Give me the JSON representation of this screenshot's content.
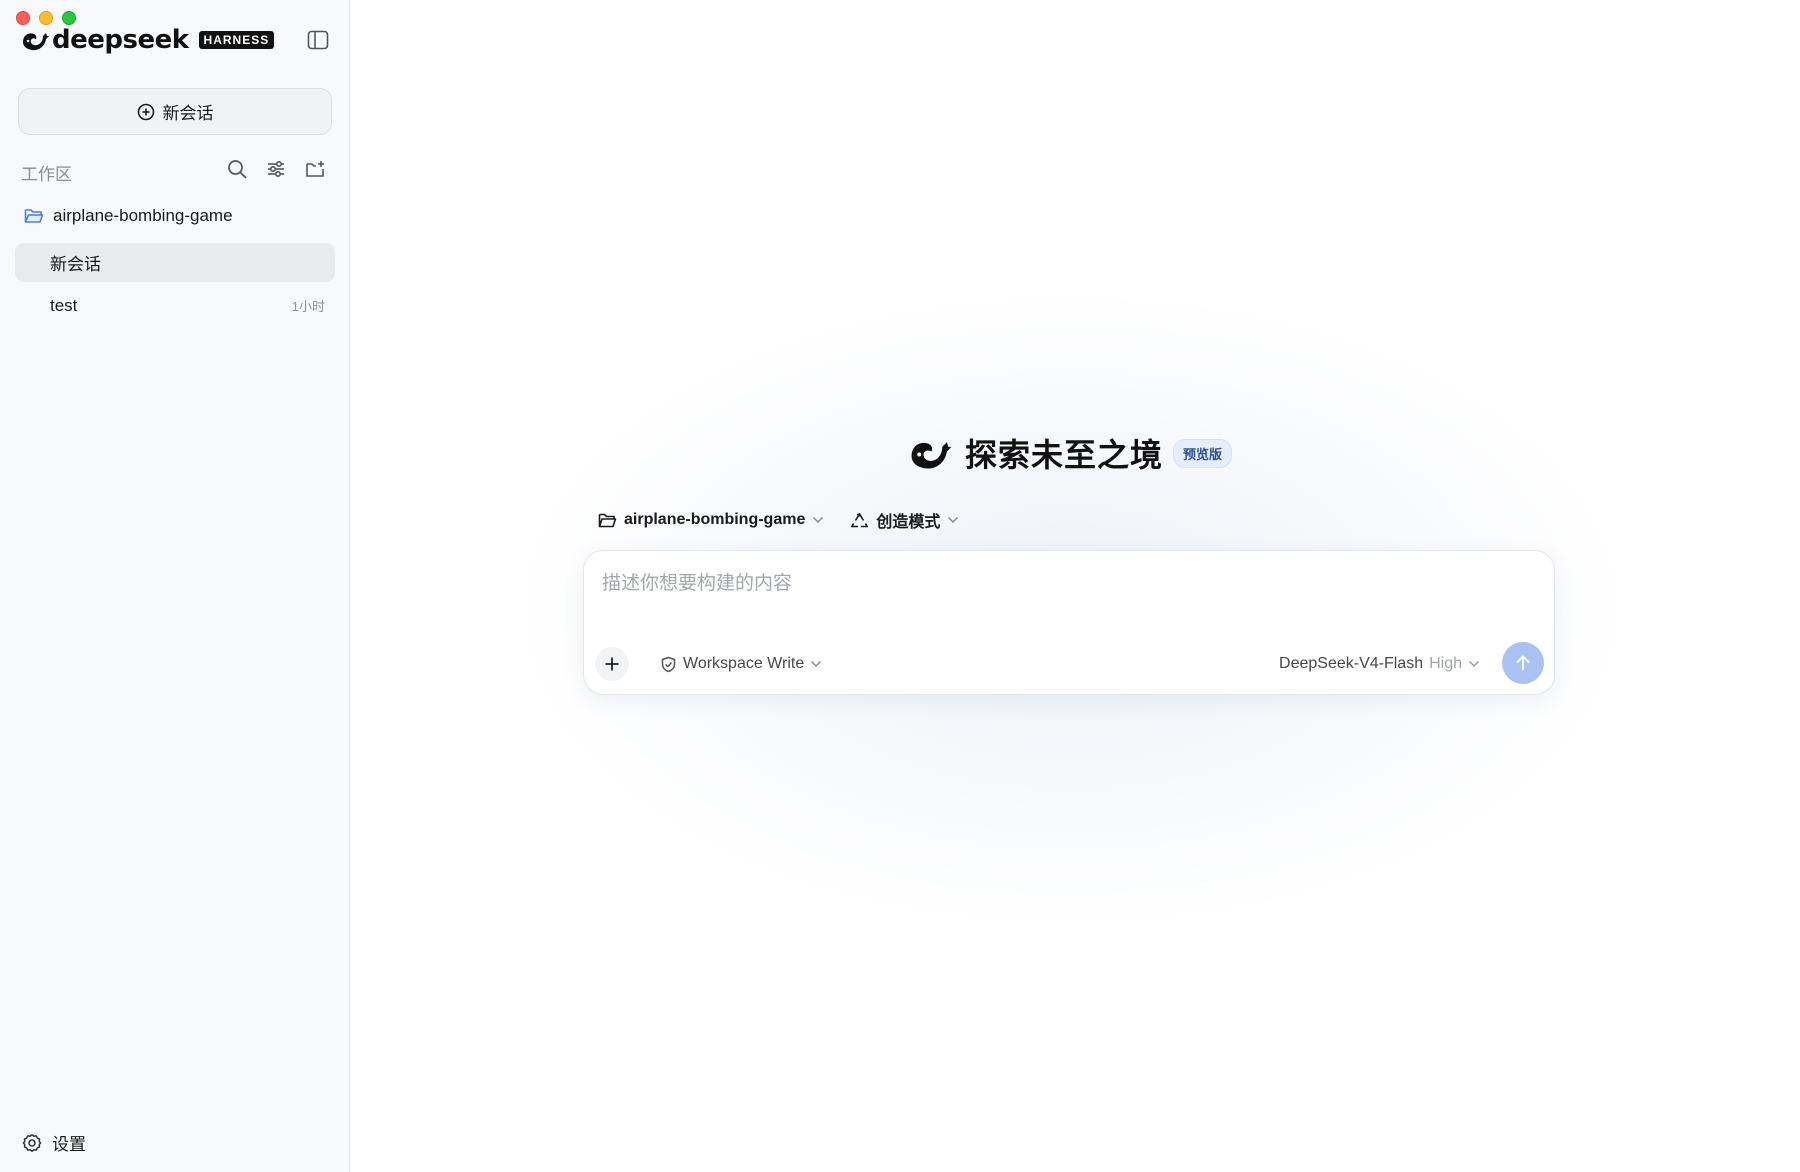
{
  "window": {
    "traffic_lights": [
      "close",
      "minimize",
      "maximize"
    ]
  },
  "sidebar": {
    "brand": {
      "word": "deepseek",
      "badge": "HARNESS",
      "logo_icon": "whale-icon"
    },
    "toggle_icon": "sidebar-panel-icon",
    "new_chat_label": "新会话",
    "workspace_label": "工作区",
    "tools": [
      "search-icon",
      "sliders-icon",
      "new-folder-icon"
    ],
    "workspace": {
      "name": "airplane-bombing-game",
      "chats": [
        {
          "title": "新会话",
          "time": "",
          "active": true
        },
        {
          "title": "test",
          "time": "1小时",
          "active": false
        }
      ]
    },
    "settings_label": "设置"
  },
  "main": {
    "hero": {
      "title": "探索未至之境",
      "badge": "预览版"
    },
    "selectors": {
      "project": "airplane-bombing-game",
      "mode": "创造模式"
    },
    "composer": {
      "placeholder": "描述你想要构建的内容",
      "permission": "Workspace Write",
      "model": "DeepSeek-V4-Flash",
      "effort": "High"
    }
  },
  "colors": {
    "accent": "#4d6bfe",
    "send_disabled": "#a9c2f4",
    "sidebar_bg": "#f8f9fb",
    "active_item_bg": "#e9eaee"
  }
}
